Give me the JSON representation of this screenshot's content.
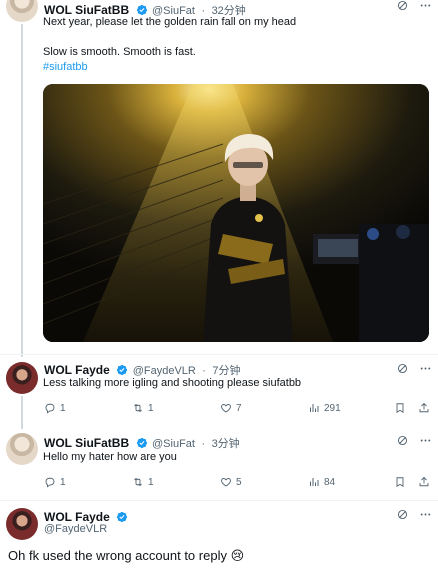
{
  "tweet1": {
    "name": "WOL SiuFatBB",
    "handle": "@SiuFat",
    "time": "32分钟",
    "line1": "Next year, please let the golden rain fall on my head",
    "line2": "Slow is smooth. Smooth is fast.",
    "hashtag": "#siufatbb",
    "photo_alt": "Person with bleached hair in a dark jacket under a golden spotlight"
  },
  "reply1": {
    "name": "WOL Fayde",
    "handle": "@FaydeVLR",
    "time": "7分钟",
    "text": "Less talking more igling and shooting please siufatbb",
    "replies": "1",
    "reposts": "1",
    "likes": "7",
    "views": "291"
  },
  "reply2": {
    "name": "WOL SiuFatBB",
    "handle": "@SiuFat",
    "time": "3分钟",
    "text": "Hello my hater how are you",
    "replies": "1",
    "reposts": "1",
    "likes": "5",
    "views": "84"
  },
  "focus": {
    "name": "WOL Fayde",
    "handle": "@FaydeVLR",
    "text": "Oh fk used the wrong account to reply",
    "emoji": "😢"
  },
  "colors": {
    "accent": "#1d9bf0",
    "secondary": "#536471"
  }
}
